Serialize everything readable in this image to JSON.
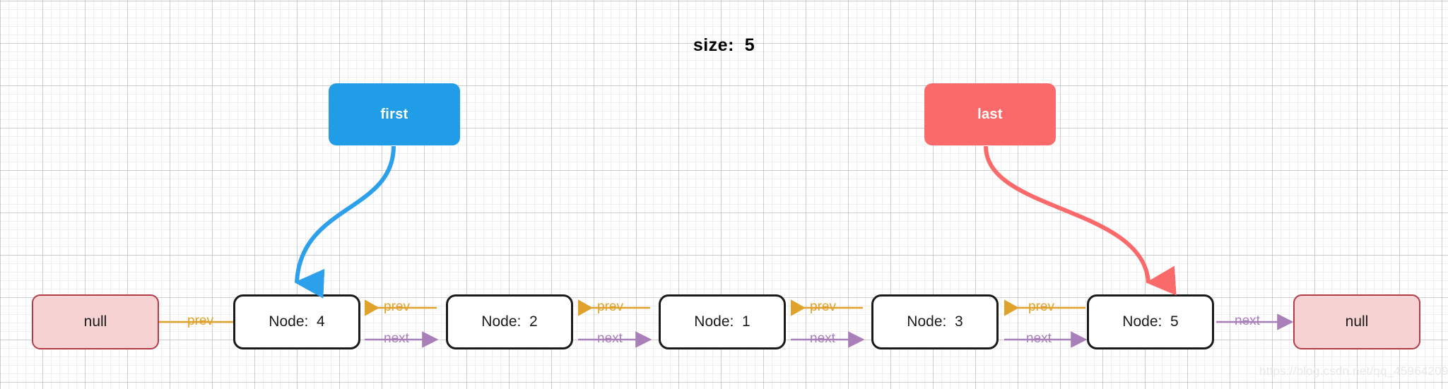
{
  "diagram": {
    "title": "size:  5",
    "watermark": "https://blog.csdn.net/qq_45964209",
    "colors": {
      "first_box": "#219DE8",
      "last_box": "#FB6A6A",
      "prev_arrow": "#E0A22A",
      "next_arrow": "#A87FB8",
      "node_border": "#1a1a1a",
      "null_fill": "#F6D3D2",
      "null_border": "#B23B48",
      "background": "#ffffff",
      "grid": "#CDCDCD"
    }
  },
  "pointers": [
    {
      "label": "first",
      "target": "Node:  4"
    },
    {
      "label": "last",
      "target": "Node:  5"
    }
  ],
  "nodes": [
    {
      "id": "null-left",
      "label": "null",
      "kind": "null"
    },
    {
      "id": "node-4",
      "label": "Node:  4",
      "kind": "node"
    },
    {
      "id": "node-2",
      "label": "Node:  2",
      "kind": "node"
    },
    {
      "id": "node-1",
      "label": "Node:  1",
      "kind": "node"
    },
    {
      "id": "node-3",
      "label": "Node:  3",
      "kind": "node"
    },
    {
      "id": "node-5",
      "label": "Node:  5",
      "kind": "node"
    },
    {
      "id": "null-right",
      "label": "null",
      "kind": "null"
    }
  ],
  "edges": [
    {
      "id": "e1",
      "label": "prev",
      "from": "node-4",
      "to": "null-left",
      "direction": "left",
      "kind": "prev"
    },
    {
      "id": "e2",
      "label": "prev",
      "from": "node-2",
      "to": "node-4",
      "direction": "left",
      "kind": "prev"
    },
    {
      "id": "e3",
      "label": "next",
      "from": "node-4",
      "to": "node-2",
      "direction": "right",
      "kind": "next"
    },
    {
      "id": "e4",
      "label": "prev",
      "from": "node-1",
      "to": "node-2",
      "direction": "left",
      "kind": "prev"
    },
    {
      "id": "e5",
      "label": "next",
      "from": "node-2",
      "to": "node-1",
      "direction": "right",
      "kind": "next"
    },
    {
      "id": "e6",
      "label": "prev",
      "from": "node-3",
      "to": "node-1",
      "direction": "left",
      "kind": "prev"
    },
    {
      "id": "e7",
      "label": "next",
      "from": "node-1",
      "to": "node-3",
      "direction": "right",
      "kind": "next"
    },
    {
      "id": "e8",
      "label": "prev",
      "from": "node-5",
      "to": "node-3",
      "direction": "left",
      "kind": "prev"
    },
    {
      "id": "e9",
      "label": "next",
      "from": "node-3",
      "to": "node-5",
      "direction": "right",
      "kind": "next"
    },
    {
      "id": "e10",
      "label": "next",
      "from": "node-5",
      "to": "null-right",
      "direction": "right",
      "kind": "next"
    }
  ]
}
